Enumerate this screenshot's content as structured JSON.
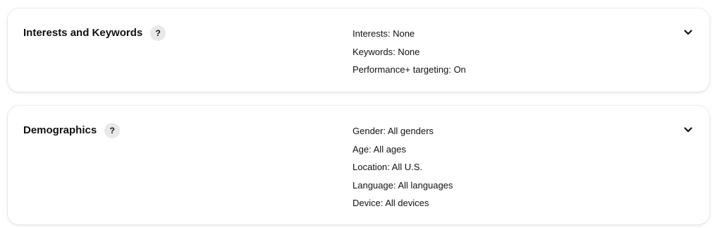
{
  "sections": [
    {
      "title": "Interests and Keywords",
      "help_label": "?",
      "summary": [
        "Interests: None",
        "Keywords: None",
        "Performance+ targeting: On"
      ]
    },
    {
      "title": "Demographics",
      "help_label": "?",
      "summary": [
        "Gender: All genders",
        "Age: All ages",
        "Location: All U.S.",
        "Language: All languages",
        "Device: All devices"
      ]
    }
  ]
}
